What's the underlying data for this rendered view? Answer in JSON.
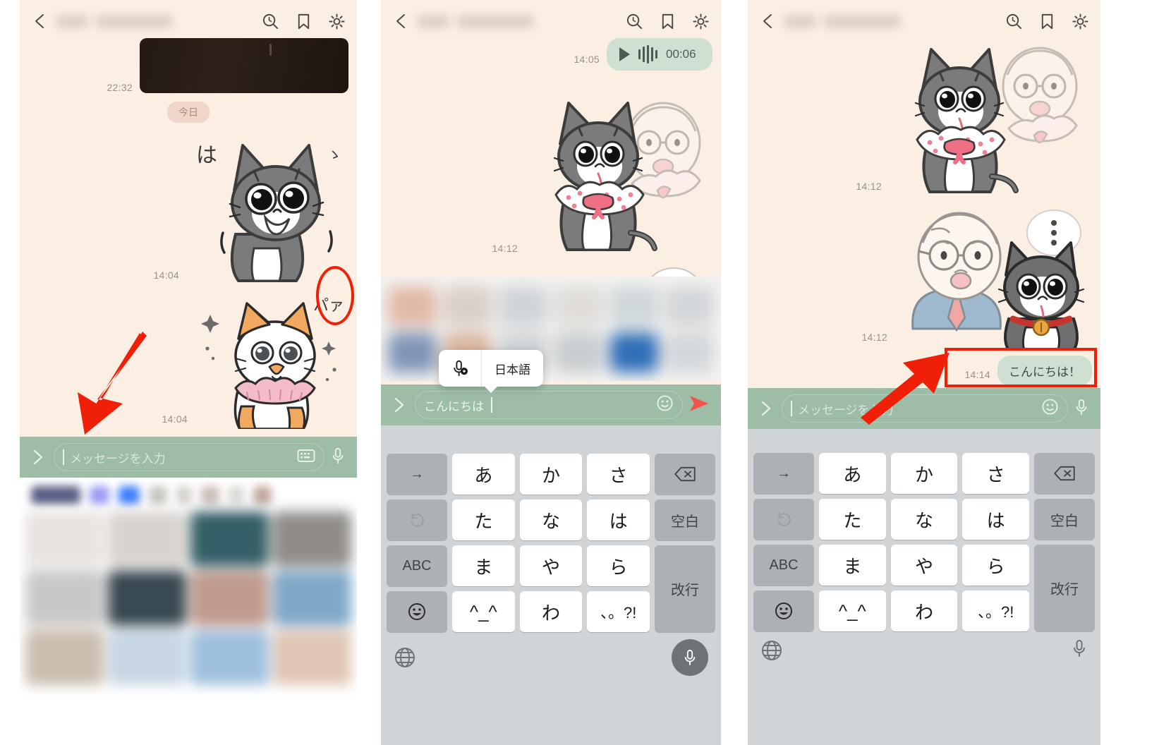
{
  "app": {
    "name": "LINE chat",
    "accent_green": "#9dbda7",
    "bubble_green": "#cfe0d2",
    "chat_bg": "#fbeee3",
    "annotation_red": "#f01f07"
  },
  "header": {
    "back_icon": "chevron-left-icon",
    "title_masked": true,
    "icons": [
      "search-clock-icon",
      "bookmark-icon",
      "gear-icon"
    ]
  },
  "panel1": {
    "messages": [
      {
        "type": "video",
        "time": "22:32"
      },
      {
        "type": "day_divider",
        "label": "今日"
      },
      {
        "type": "sticker",
        "time": "14:04",
        "sticker": "gray-cat-surprised-sticker",
        "overlay_text": "は"
      },
      {
        "type": "sticker",
        "time": "14:04",
        "sticker": "orange-white-cat-frill-sticker",
        "overlay_text": "パァ"
      }
    ],
    "input": {
      "chevron": "chevron-right-icon",
      "placeholder": "メッセージを入力",
      "value": "",
      "keyboard_icon": "keyboard-icon",
      "mic_icon": "microphone-icon"
    },
    "sticker_tray": {
      "blurred": true,
      "tab_colors": [
        "#5a5f86",
        "#9a9cf4",
        "#3d7ffb",
        "#c9c5c0",
        "#d6d2cd",
        "#cdbdb6",
        "#ddd9d4",
        "#c3a99d"
      ],
      "cell_colors": [
        "#e8e3e0",
        "#d8d3cf",
        "#355f68",
        "#8f8c89",
        "#c9c8c6",
        "#3a4a52",
        "#c09a8d",
        "#7fa8c8",
        "#cbbdae",
        "#c8d6e4",
        "#9fc0dd",
        "#e0c6b4"
      ]
    },
    "annotation": {
      "arrow": "red-arrow-pointing-down-left",
      "mic_highlight": "red-oval-around-mic-button"
    }
  },
  "panel2": {
    "messages": [
      {
        "type": "voice",
        "time": "14:05",
        "duration": "00:06",
        "play_icon": "play-icon",
        "waveform": "waveform-icon"
      },
      {
        "type": "sticker",
        "time": "14:12",
        "sticker": "gray-cat-with-frill-collar-and-old-man-sticker"
      },
      {
        "type": "sticker",
        "sticker": "old-man-with-speech-dots-sticker"
      }
    ],
    "suggestion_strip": {
      "blurred": true
    },
    "ime_popup": {
      "mic_setting_icon": "microphone-settings-icon",
      "language_label": "日本語"
    },
    "input": {
      "chevron": "chevron-right-icon",
      "placeholder": "メッセージを入力",
      "value": "こんにちは",
      "emoji_icon": "smiley-icon",
      "send_icon": "send-icon"
    }
  },
  "panel3": {
    "messages": [
      {
        "type": "sticker",
        "time": "14:12",
        "sticker": "gray-cat-with-frill-collar-and-old-man-sticker"
      },
      {
        "type": "sticker",
        "time": "14:12",
        "sticker": "old-man-with-cat-and-dots-sticker"
      },
      {
        "type": "text",
        "time": "14:14",
        "text": "こんにちは！",
        "side": "right"
      }
    ],
    "input": {
      "chevron": "chevron-right-icon",
      "placeholder": "メッセージを入力",
      "value": "",
      "emoji_icon": "smiley-icon",
      "mic_icon": "microphone-icon"
    },
    "annotation": {
      "arrow": "red-arrow-pointing-up-right",
      "box": "red-rectangle-around-sent-message"
    }
  },
  "keyboard": {
    "rows": [
      [
        {
          "label": "→",
          "kind": "fn"
        },
        {
          "label": "あ",
          "kind": "key"
        },
        {
          "label": "か",
          "kind": "key"
        },
        {
          "label": "さ",
          "kind": "key"
        },
        {
          "label": "delete-icon",
          "kind": "fn-icon"
        }
      ],
      [
        {
          "label": "↺",
          "kind": "fn-icon"
        },
        {
          "label": "た",
          "kind": "key"
        },
        {
          "label": "な",
          "kind": "key"
        },
        {
          "label": "は",
          "kind": "key"
        },
        {
          "label": "空白",
          "kind": "fn"
        }
      ],
      [
        {
          "label": "ABC",
          "kind": "fn"
        },
        {
          "label": "ま",
          "kind": "key"
        },
        {
          "label": "や",
          "kind": "key"
        },
        {
          "label": "ら",
          "kind": "key"
        },
        {
          "label": "改行",
          "kind": "fn"
        }
      ],
      [
        {
          "label": "emoji-icon",
          "kind": "fn-icon"
        },
        {
          "label": "^_^",
          "kind": "key"
        },
        {
          "label": "わ",
          "kind": "key"
        },
        {
          "label": "、。?!",
          "kind": "key"
        }
      ]
    ],
    "keys": {
      "arrow_right": "→",
      "a": "あ",
      "ka": "か",
      "sa": "さ",
      "ta": "た",
      "na": "な",
      "ha": "は",
      "ma": "ま",
      "ya": "や",
      "ra": "ら",
      "kaomoji": "^_^",
      "wa": "わ",
      "punct": "、。?!",
      "space": "空白",
      "enter": "改行",
      "abc": "ABC"
    },
    "bottom": {
      "globe_icon": "globe-icon",
      "mic_icon": "microphone-icon"
    }
  }
}
